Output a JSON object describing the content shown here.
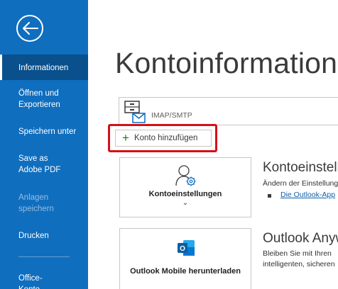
{
  "sidebar": {
    "items": [
      {
        "label": "Informationen",
        "active": true
      },
      {
        "label": "Öffnen und Exportieren"
      },
      {
        "label": "Speichern unter"
      },
      {
        "label": "Save as Adobe PDF"
      },
      {
        "label": "Anlagen speichern",
        "disabled": true
      },
      {
        "label": "Drucken"
      },
      {
        "label": "Office-Konto"
      }
    ]
  },
  "main": {
    "title": "Kontoinformationen",
    "account": {
      "type": "IMAP/SMTP"
    },
    "add_account_button": "Konto hinzufügen",
    "tiles": [
      {
        "label": "Kontoeinstellungen",
        "chevron": "⌄"
      },
      {
        "label": "Outlook Mobile herunterladen"
      }
    ],
    "sections": [
      {
        "heading": "Kontoeinstellungen",
        "text": "Ändern der Einstellungen",
        "link": "Die Outlook-App"
      },
      {
        "heading": "Outlook Anywhere",
        "text_lines": [
          "Bleiben Sie mit Ihren",
          "intelligenten, sicheren"
        ]
      }
    ]
  },
  "colors": {
    "sidebar": "#106ebe",
    "active": "#09508c",
    "highlight": "#d80f17",
    "plus": "#107c10",
    "link": "#0f5fa8"
  }
}
